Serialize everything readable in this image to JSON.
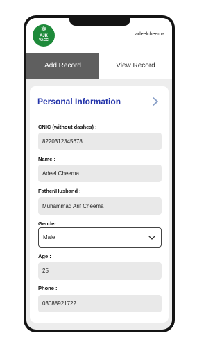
{
  "app": {
    "logo_line1": "AJK",
    "logo_line2": "VACC",
    "username": "adeelcheema",
    "colors": {
      "logo_green": "#1e8a3a",
      "title_blue": "#2233aa",
      "active_tab": "#5f5f5f"
    }
  },
  "tabs": [
    {
      "label": "Add Record",
      "active": true
    },
    {
      "label": "View Record",
      "active": false
    }
  ],
  "form": {
    "title": "Personal Information",
    "cnic": {
      "label": "CNIC (without dashes) :",
      "value": "8220312345678"
    },
    "name": {
      "label": "Name :",
      "value": "Adeel Cheema"
    },
    "father": {
      "label": "Father/Husband :",
      "value": "Muhammad Arif Cheema"
    },
    "gender": {
      "label": "Gender :",
      "value": "Male"
    },
    "age": {
      "label": "Age :",
      "value": "25"
    },
    "phone": {
      "label": "Phone :",
      "value": "03088921722"
    }
  }
}
